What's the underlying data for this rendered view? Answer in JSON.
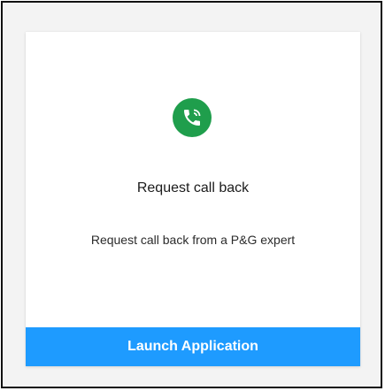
{
  "card": {
    "icon": "phone-callback-icon",
    "title": "Request call back",
    "description": "Request call back from a P&G expert",
    "action_label": "Launch Application"
  },
  "colors": {
    "icon_background": "#1f9e4c",
    "button_background": "#1e9bff",
    "button_text": "#ffffff",
    "card_background": "#ffffff",
    "page_background": "#f3f3f3"
  }
}
